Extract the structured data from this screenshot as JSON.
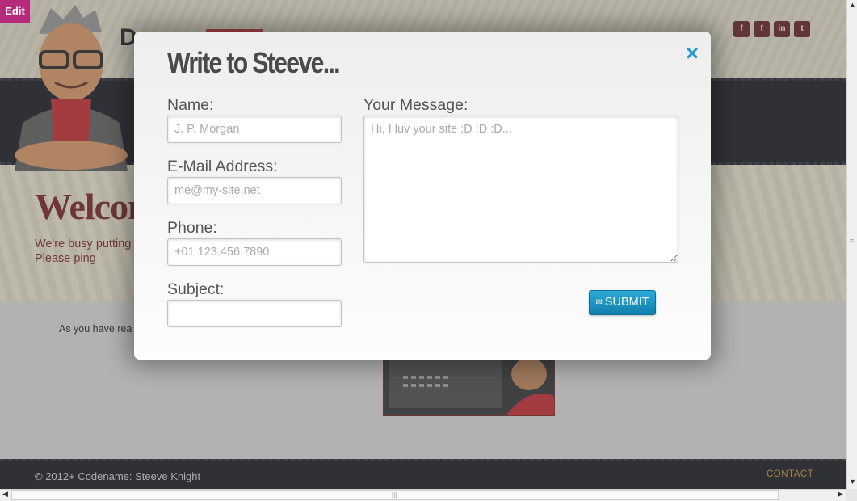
{
  "edit_tab": {
    "label": "Edit"
  },
  "header": {
    "logo_fragment": "D",
    "social_icons": [
      "facebook-icon",
      "facebook-icon",
      "linkedin-icon",
      "twitter-icon"
    ]
  },
  "hero": {
    "welcome_title": "Welcom",
    "welcome_text": "We're busy putting posts. Please ping"
  },
  "content": {
    "text": "As you have rea be soon. Thanks"
  },
  "footer": {
    "copyright": "© 2012+ Codename: Steeve Knight",
    "contact_label": "CONTACT"
  },
  "modal": {
    "title": "Write to Steeve...",
    "close_label": "×",
    "fields": {
      "name": {
        "label": "Name:",
        "value": "",
        "placeholder": "J. P. Morgan"
      },
      "email": {
        "label": "E-Mail Address:",
        "value": "",
        "placeholder": "me@my-site.net"
      },
      "phone": {
        "label": "Phone:",
        "value": "",
        "placeholder": "+01 123.456.7890"
      },
      "subject": {
        "label": "Subject:",
        "value": "",
        "placeholder": ""
      },
      "message": {
        "label": "Your Message:",
        "value": "",
        "placeholder": "Hi, I luv your site :D :D :D..."
      }
    },
    "submit_label": "SUBMIT"
  },
  "colors": {
    "accent": "#2b9bd1",
    "brand_dark_red": "#6b1f1c",
    "edit_tab": "#b52a7a",
    "footer_contact": "#b58a2b"
  }
}
